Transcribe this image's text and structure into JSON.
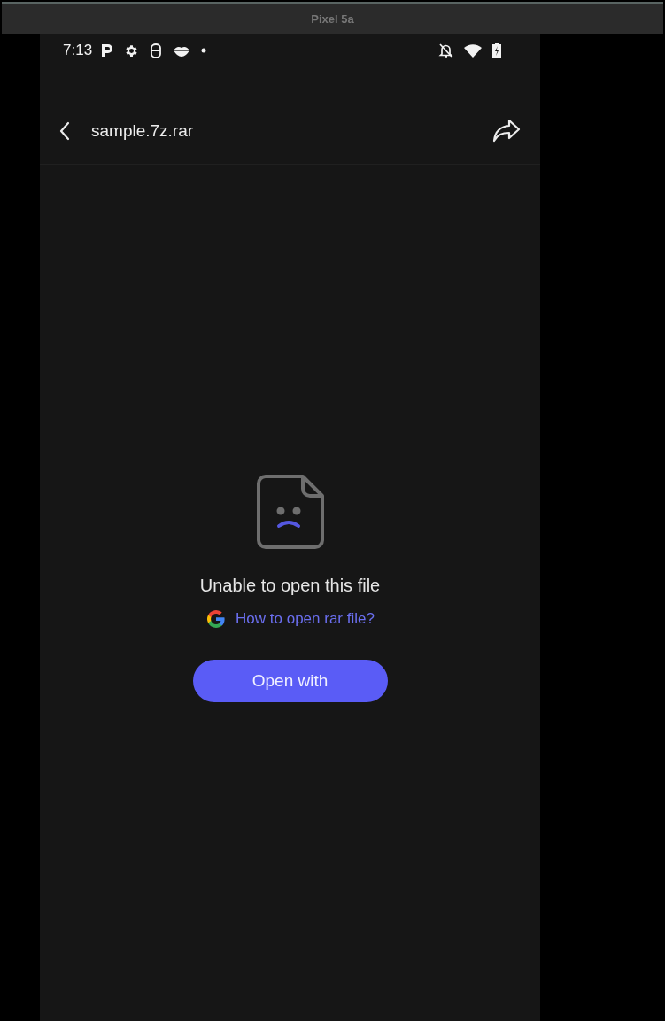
{
  "window": {
    "title": "Pixel 5a"
  },
  "status_bar": {
    "time": "7:13"
  },
  "app_bar": {
    "title": "sample.7z.rar"
  },
  "error": {
    "message": "Unable to open this file",
    "help_link": "How to open rar file?",
    "button": "Open with"
  }
}
